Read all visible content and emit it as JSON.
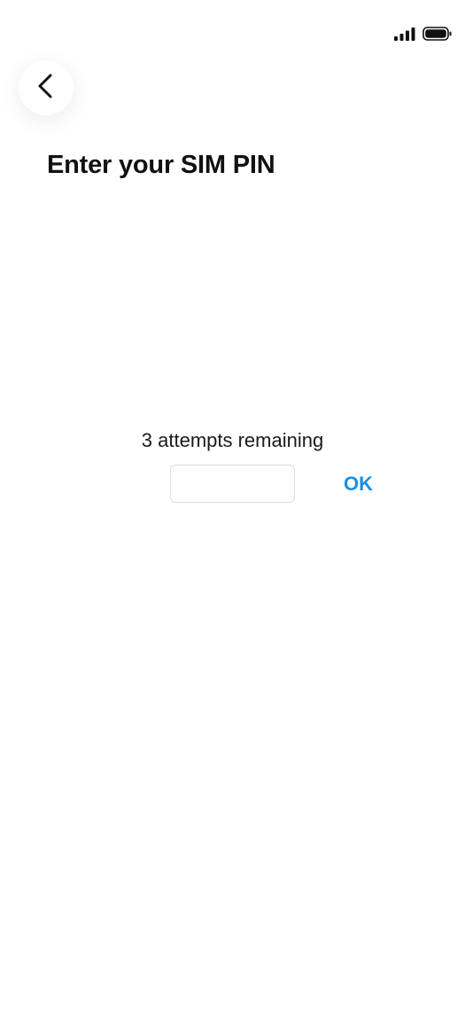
{
  "status_bar": {
    "signal_icon": "cellular-signal-icon",
    "battery_icon": "battery-icon"
  },
  "header": {
    "back_icon": "chevron-left-icon",
    "title": "Enter your SIM PIN"
  },
  "pin_entry": {
    "attempts_text": "3 attempts remaining",
    "input_value": "",
    "input_placeholder": "",
    "ok_label": "OK"
  },
  "colors": {
    "accent": "#1a8fe3",
    "text": "#111111",
    "background": "#ffffff",
    "input_border": "#dcdcdc"
  }
}
